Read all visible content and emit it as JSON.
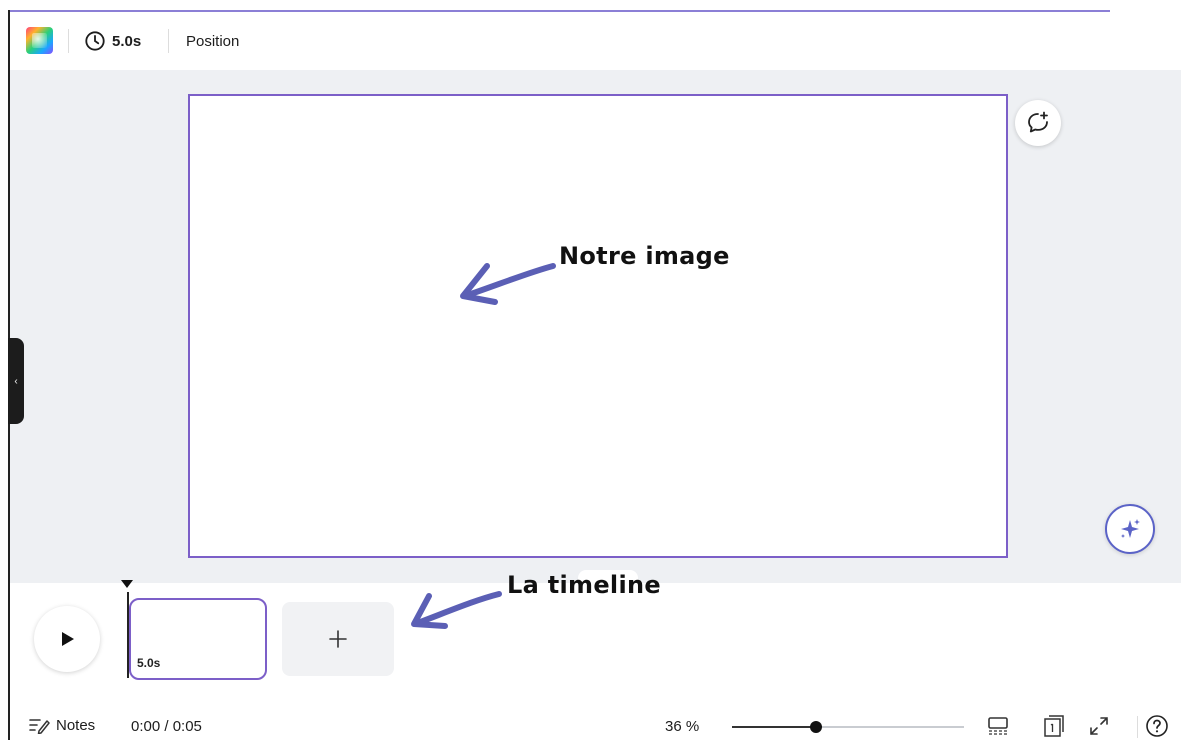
{
  "toolbar": {
    "color_picker_icon": "color-gradient-icon",
    "duration_label": "5.0s",
    "position_label": "Position"
  },
  "canvas": {
    "collapse_glyph": "‹",
    "comment_icon": "comment-add-icon",
    "magic_icon": "sparkle-icon"
  },
  "annotations": {
    "image_label": "Notre image",
    "timeline_label": "La timeline",
    "arrow_color": "#5b5fb5"
  },
  "timeline": {
    "clips": [
      {
        "duration": "5.0s"
      }
    ],
    "add_label": "+"
  },
  "footer": {
    "notes_label": "Notes",
    "time_readout": "0:00 / 0:05",
    "zoom_label": "36 %",
    "zoom_value_percent": 36
  },
  "colors": {
    "accent": "#7c5fc8",
    "canvas_bg": "#eef0f3",
    "magic_ring": "#5b63c7"
  }
}
